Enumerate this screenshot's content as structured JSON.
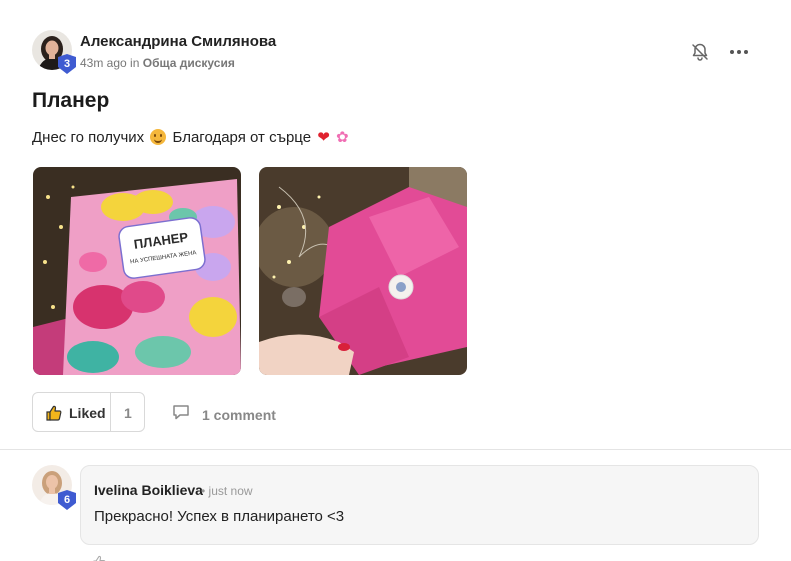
{
  "post": {
    "author": {
      "name": "Александрина Смилянова",
      "level": "3"
    },
    "meta": {
      "time": "43m ago",
      "in": "in",
      "category": "Обща дискусия"
    },
    "title": "Планер",
    "body": {
      "part1": "Днес го получих",
      "part2": "Благодаря от сърце"
    },
    "images": [
      {
        "alt": "Планер на успешната жена",
        "cover_title": "ПЛАНЕР",
        "cover_sub": "НА УСПЕШНАТА ЖЕНА"
      },
      {
        "alt": "Pink wrapped gift package"
      }
    ],
    "actions": {
      "like_label": "Liked",
      "like_count": "1",
      "comment_label": "1 comment"
    }
  },
  "comment": {
    "author": "Ivelina Boiklieva",
    "level": "6",
    "time": "• just now",
    "text": "Прекрасно! Успех в планирането <3"
  },
  "colors": {
    "badge": "#3f5bd1",
    "like_icon": "#f2b51b",
    "heart": "#e0222f",
    "flower": "#f06fb4"
  },
  "icons": [
    "bell-off-icon",
    "more-horizontal-icon",
    "thumbs-up-icon",
    "comment-icon",
    "smile-emoji",
    "heart-emoji",
    "flower-emoji"
  ]
}
